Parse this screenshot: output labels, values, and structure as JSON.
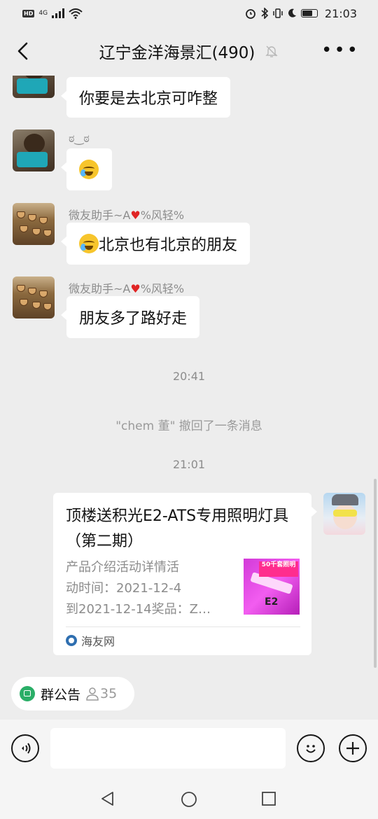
{
  "status_bar": {
    "hd": "HD",
    "network": "4G",
    "time": "21:03"
  },
  "header": {
    "title": "辽宁金洋海景汇(490)"
  },
  "messages": [
    {
      "text": "你要是去北京可咋整"
    },
    {
      "sender": "ಠ‿ಠ",
      "emoji": "crying-face"
    },
    {
      "sender_prefix": "微友助手~A",
      "sender_suffix": "%风轻%",
      "text": "北京也有北京的朋友",
      "emoji": "crying-laughing-face"
    },
    {
      "sender_prefix": "微友助手~A",
      "sender_suffix": "%风轻%",
      "text": "朋友多了路好走"
    }
  ],
  "system": {
    "time1": "20:41",
    "recall": "\"chem 董\" 撤回了一条消息",
    "time2": "21:01"
  },
  "card": {
    "title": "顶楼送积光E2-ATS专用照明灯具（第二期）",
    "desc": [
      "产品介绍活动详情活",
      "动时间：2021-12-4",
      "到2021-12-14奖品：Z…"
    ],
    "thumb_banner": "50千套照明",
    "thumb_text": "E2",
    "source": "海友网"
  },
  "notice": {
    "label": "群公告",
    "count": "35"
  },
  "input": {
    "placeholder": ""
  },
  "colors": {
    "background": "#ededed",
    "bubble": "#ffffff",
    "accent_green": "#2aae67",
    "heart": "#e02525"
  }
}
